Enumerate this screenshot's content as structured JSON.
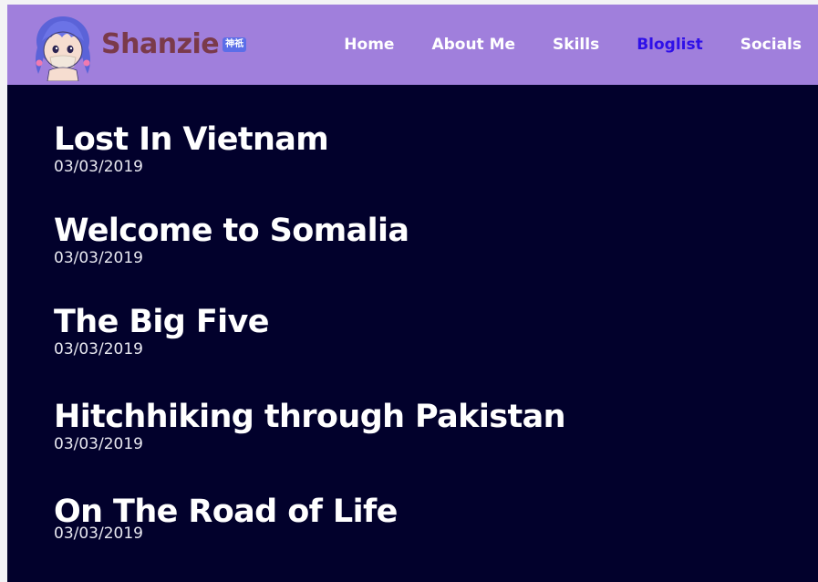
{
  "brand": {
    "name": "Shanzie",
    "badge": "神祇"
  },
  "nav": {
    "items": [
      {
        "label": "Home"
      },
      {
        "label": "About Me"
      },
      {
        "label": "Skills"
      },
      {
        "label": "Bloglist",
        "active": true
      },
      {
        "label": "Socials"
      }
    ]
  },
  "posts": [
    {
      "title": "Lost In Vietnam",
      "date": "03/03/2019"
    },
    {
      "title": "Welcome to Somalia",
      "date": "03/03/2019"
    },
    {
      "title": "The Big Five",
      "date": "03/03/2019"
    },
    {
      "title": "Hitchhiking through Pakistan",
      "date": "03/03/2019"
    },
    {
      "title": "On The Road of Life",
      "date": "03/03/2019"
    }
  ],
  "colors": {
    "navbar_bg": "#a07fdc",
    "content_bg": "#02012c",
    "active_link": "#2f10e8",
    "brand_text": "#7a3a4a"
  }
}
